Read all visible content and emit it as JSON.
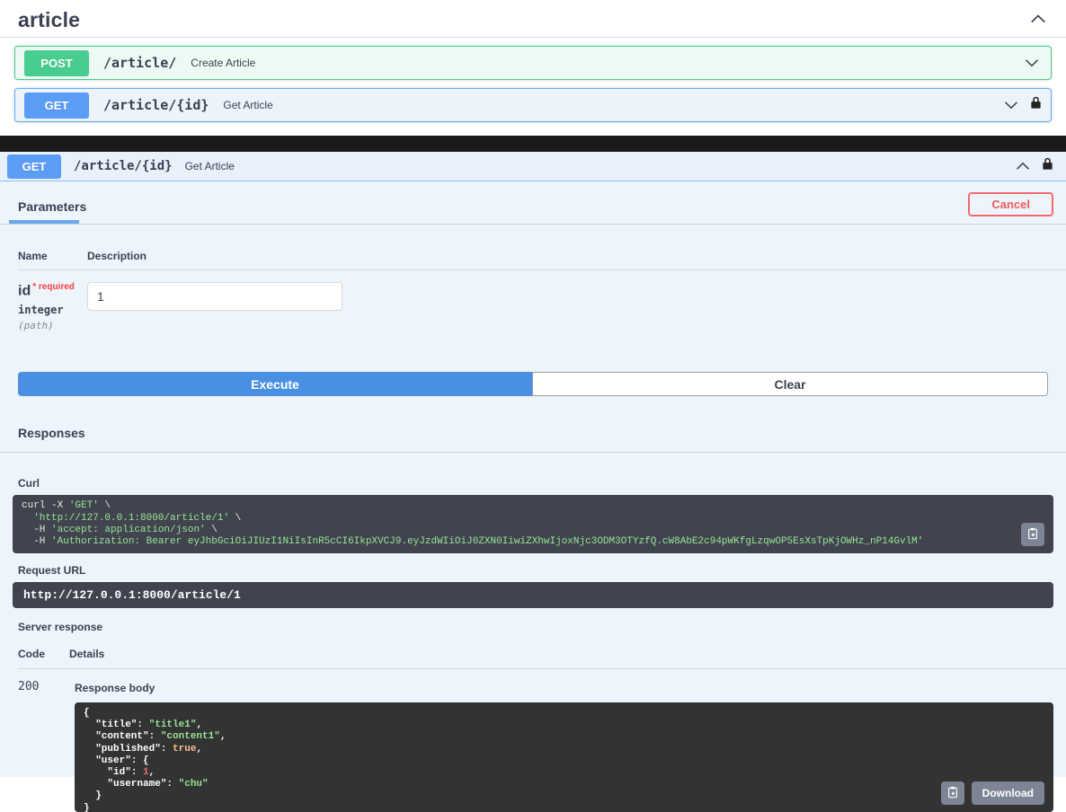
{
  "tag_section": {
    "title": "article",
    "operations": [
      {
        "method": "POST",
        "path": "/article/",
        "summary": "Create Article",
        "locked": false
      },
      {
        "method": "GET",
        "path": "/article/{id}",
        "summary": "Get Article",
        "locked": true
      }
    ]
  },
  "expanded_op": {
    "method": "GET",
    "path": "/article/{id}",
    "summary": "Get Article",
    "parameters_tab_label": "Parameters",
    "cancel_label": "Cancel",
    "param_table": {
      "name_header": "Name",
      "description_header": "Description"
    },
    "parameter": {
      "name": "id",
      "required_label": "* required",
      "type": "integer",
      "location": "(path)",
      "value": "1"
    },
    "execute_label": "Execute",
    "clear_label": "Clear",
    "responses": {
      "title": "Responses",
      "curl_label": "Curl",
      "curl_lines": [
        [
          [
            "curl -X ",
            "c"
          ],
          [
            "'GET'",
            "s"
          ],
          [
            " \\",
            "c"
          ]
        ],
        [
          [
            "  ",
            "c"
          ],
          [
            "'http://127.0.0.1:8000/article/1'",
            "s"
          ],
          [
            " \\",
            "c"
          ]
        ],
        [
          [
            "  -H ",
            "c"
          ],
          [
            "'accept: application/json'",
            "s"
          ],
          [
            " \\",
            "c"
          ]
        ],
        [
          [
            "  -H ",
            "c"
          ],
          [
            "'Authorization: Bearer eyJhbGciOiJIUzI1NiIsInR5cCI6IkpXVCJ9.eyJzdWIiOiJ0ZXN0IiwiZXhwIjoxNjc3ODM3OTYzfQ.cW8AbE2c94pWKfgLzqwOP5EsXsTpKjOWHz_nP14GvlM'",
            "s"
          ]
        ]
      ],
      "request_url_label": "Request URL",
      "request_url": "http://127.0.0.1:8000/article/1",
      "server_response_label": "Server response",
      "code_header": "Code",
      "details_header": "Details",
      "status_code": "200",
      "response_body_label": "Response body",
      "response_lines": [
        [
          [
            "{",
            "p"
          ]
        ],
        [
          [
            "  ",
            "p"
          ],
          [
            "\"title\"",
            "k"
          ],
          [
            ": ",
            "p"
          ],
          [
            "\"title1\"",
            "s"
          ],
          [
            ",",
            "p"
          ]
        ],
        [
          [
            "  ",
            "p"
          ],
          [
            "\"content\"",
            "k"
          ],
          [
            ": ",
            "p"
          ],
          [
            "\"content1\"",
            "s"
          ],
          [
            ",",
            "p"
          ]
        ],
        [
          [
            "  ",
            "p"
          ],
          [
            "\"published\"",
            "k"
          ],
          [
            ": ",
            "p"
          ],
          [
            "true",
            "b"
          ],
          [
            ",",
            "p"
          ]
        ],
        [
          [
            "  ",
            "p"
          ],
          [
            "\"user\"",
            "k"
          ],
          [
            ": {",
            "p"
          ]
        ],
        [
          [
            "    ",
            "p"
          ],
          [
            "\"id\"",
            "k"
          ],
          [
            ": ",
            "p"
          ],
          [
            "1",
            "n"
          ],
          [
            ",",
            "p"
          ]
        ],
        [
          [
            "    ",
            "p"
          ],
          [
            "\"username\"",
            "k"
          ],
          [
            ": ",
            "p"
          ],
          [
            "\"chu\"",
            "s"
          ]
        ],
        [
          [
            "  }",
            "p"
          ]
        ],
        [
          [
            "}",
            "p"
          ]
        ]
      ],
      "download_label": "Download"
    }
  },
  "colors": {
    "post_badge": "#49cc90",
    "get_badge": "#5b9cf4",
    "execute_blue": "#4990e2",
    "cancel_red": "#ef5a5a",
    "code_block_bg": "#41444e",
    "response_block_bg": "#333333",
    "string_green": "#97e597",
    "bool_orange": "#fcc28c",
    "number_red": "#e06c6c",
    "text": "#3b4151"
  }
}
